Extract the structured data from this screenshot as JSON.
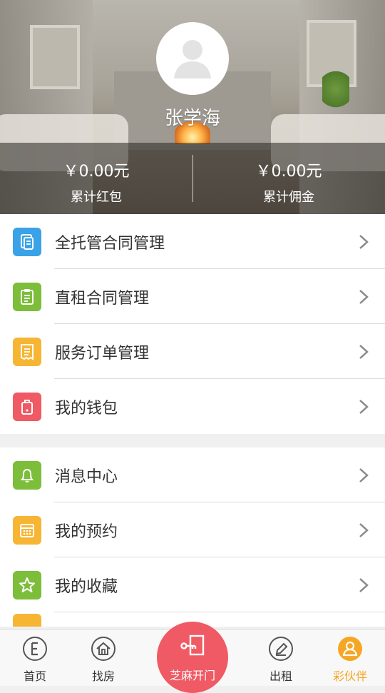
{
  "profile": {
    "name": "张学海",
    "red_packet_amount": "￥0.00元",
    "red_packet_label": "累计红包",
    "commission_amount": "￥0.00元",
    "commission_label": "累计佣金"
  },
  "menu_group_1": [
    {
      "label": "全托管合同管理",
      "icon": "document-icon",
      "color": "#3aa2e6"
    },
    {
      "label": "直租合同管理",
      "icon": "clipboard-icon",
      "color": "#7cbd3a"
    },
    {
      "label": "服务订单管理",
      "icon": "receipt-icon",
      "color": "#f7b534"
    },
    {
      "label": "我的钱包",
      "icon": "wallet-icon",
      "color": "#ef5a64"
    }
  ],
  "menu_group_2": [
    {
      "label": "消息中心",
      "icon": "bell-icon",
      "color": "#7cbd3a"
    },
    {
      "label": "我的预约",
      "icon": "calendar-icon",
      "color": "#f7b534"
    },
    {
      "label": "我的收藏",
      "icon": "star-icon",
      "color": "#7cbd3a"
    }
  ],
  "tabbar": {
    "home": "首页",
    "find_house": "找房",
    "open_door": "芝麻开门",
    "rent_out": "出租",
    "partner": "彩伙伴"
  },
  "colors": {
    "accent": "#f5a623",
    "fab": "#ef5a64"
  }
}
